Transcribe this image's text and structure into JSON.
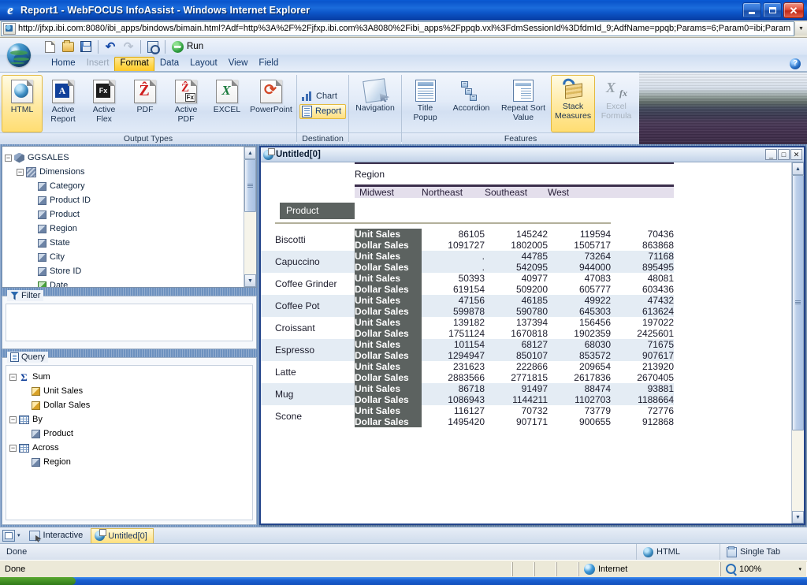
{
  "window": {
    "title": "Report1 - WebFOCUS InfoAssist - Windows Internet Explorer",
    "browser_icon": "ie-e-icon",
    "minimize_label": "Minimize",
    "maximize_label": "Maximize",
    "close_label": "Close"
  },
  "address": {
    "url": "http://jfxp.ibi.com:8080/ibi_apps/bindows/bimain.html?Adf=http%3A%2F%2Fjfxp.ibi.com%3A8080%2Fibi_apps%2Fppqb.vxl%3FdmSessionId%3DfdmId_9;AdfName=ppqb;Params=6;Param0=ibi;Param",
    "dropdown_glyph": "▼"
  },
  "quick_toolbar": {
    "buttons": [
      {
        "name": "new",
        "icon": "new-document-icon"
      },
      {
        "name": "open",
        "icon": "open-folder-icon"
      },
      {
        "name": "save",
        "icon": "save-disk-icon"
      },
      {
        "name": "undo",
        "icon": "undo-arrow-icon"
      },
      {
        "name": "redo",
        "icon": "redo-arrow-icon"
      },
      {
        "name": "preview",
        "icon": "preview-icon"
      }
    ],
    "run_label": "Run",
    "run_icon": "run-play-icon"
  },
  "menu": {
    "items": [
      {
        "label": "Home",
        "state": "normal"
      },
      {
        "label": "Insert",
        "state": "disabled"
      },
      {
        "label": "Format",
        "state": "active"
      },
      {
        "label": "Data",
        "state": "normal"
      },
      {
        "label": "Layout",
        "state": "normal"
      },
      {
        "label": "View",
        "state": "normal"
      },
      {
        "label": "Field",
        "state": "normal"
      }
    ],
    "help_glyph": "?"
  },
  "ribbon": {
    "groups": [
      {
        "title": "Output Types",
        "buttons": [
          {
            "label": "HTML",
            "icon": "html-globe-icon",
            "selected": true
          },
          {
            "label": "Active\nReport",
            "icon": "active-report-icon",
            "selected": false
          },
          {
            "label": "Active\nFlex",
            "icon": "active-flex-icon",
            "selected": false
          },
          {
            "label": "PDF",
            "icon": "pdf-icon",
            "selected": false
          },
          {
            "label": "Active\nPDF",
            "icon": "active-pdf-icon",
            "selected": false
          },
          {
            "label": "EXCEL",
            "icon": "excel-icon",
            "selected": false
          },
          {
            "label": "PowerPoint",
            "icon": "powerpoint-icon",
            "selected": false
          }
        ]
      },
      {
        "title": "Destination",
        "buttons": [
          {
            "label": "Chart",
            "icon": "chart-bars-icon",
            "selected": false
          },
          {
            "label": "Report",
            "icon": "report-page-icon",
            "selected": true
          }
        ]
      },
      {
        "title": "",
        "buttons": [
          {
            "label": "Navigation",
            "icon": "navigation-icon",
            "selected": false
          }
        ]
      },
      {
        "title": "Features",
        "buttons": [
          {
            "label": "Title\nPopup",
            "icon": "title-popup-icon",
            "selected": false,
            "disabled": false
          },
          {
            "label": "Accordion",
            "icon": "accordion-icon",
            "selected": false,
            "disabled": false
          },
          {
            "label": "Repeat Sort\nValue",
            "icon": "repeat-sort-icon",
            "selected": false,
            "disabled": false
          },
          {
            "label": "Stack\nMeasures",
            "icon": "stack-measures-icon",
            "selected": true,
            "disabled": false
          },
          {
            "label": "Excel\nFormula",
            "icon": "excel-formula-icon",
            "selected": false,
            "disabled": true
          }
        ]
      }
    ]
  },
  "data_tree": {
    "root": {
      "label": "GGSALES",
      "icon": "cube-icon",
      "expander": "−"
    },
    "dimensions": {
      "label": "Dimensions",
      "icon": "dimensions-icon",
      "expander": "−"
    },
    "fields": [
      {
        "label": "Category",
        "icon": "field-icon"
      },
      {
        "label": "Product ID",
        "icon": "field-icon"
      },
      {
        "label": "Product",
        "icon": "field-icon"
      },
      {
        "label": "Region",
        "icon": "field-icon"
      },
      {
        "label": "State",
        "icon": "field-icon"
      },
      {
        "label": "City",
        "icon": "field-icon"
      },
      {
        "label": "Store ID",
        "icon": "field-icon"
      },
      {
        "label": "Date",
        "icon": "field-date-icon"
      }
    ]
  },
  "filter_panel": {
    "title": "Filter",
    "icon": "filter-funnel-icon",
    "content": ""
  },
  "query_panel": {
    "title": "Query",
    "icon": "query-page-icon",
    "nodes": [
      {
        "label": "Sum",
        "icon": "sigma-icon",
        "expander": "−",
        "level": 0
      },
      {
        "label": "Unit Sales",
        "icon": "measure-field-icon",
        "level": 1
      },
      {
        "label": "Dollar Sales",
        "icon": "measure-field-icon",
        "level": 1
      },
      {
        "label": "By",
        "icon": "grid-icon",
        "expander": "−",
        "level": 0
      },
      {
        "label": "Product",
        "icon": "field-icon",
        "level": 1
      },
      {
        "label": "Across",
        "icon": "grid-icon",
        "expander": "−",
        "level": 0
      },
      {
        "label": "Region",
        "icon": "field-icon",
        "level": 1
      }
    ]
  },
  "report_window": {
    "title": "Untitled[0]",
    "icon": "document-globe-icon",
    "minimize_glyph": "_",
    "maximize_glyph": "□",
    "close_glyph": "✕"
  },
  "report": {
    "across_title": "Region",
    "across_columns": [
      "Midwest",
      "Northeast",
      "Southeast",
      "West"
    ],
    "sort_label": "Product",
    "measures": [
      "Unit Sales",
      "Dollar Sales"
    ],
    "rows": [
      {
        "product": "Biscotti",
        "unit_sales": [
          "86105",
          "145242",
          "119594",
          "70436"
        ],
        "dollar_sales": [
          "1091727",
          "1802005",
          "1505717",
          "863868"
        ]
      },
      {
        "product": "Capuccino",
        "unit_sales": [
          ".",
          "44785",
          "73264",
          "71168"
        ],
        "dollar_sales": [
          ".",
          "542095",
          "944000",
          "895495"
        ]
      },
      {
        "product": "Coffee Grinder",
        "unit_sales": [
          "50393",
          "40977",
          "47083",
          "48081"
        ],
        "dollar_sales": [
          "619154",
          "509200",
          "605777",
          "603436"
        ]
      },
      {
        "product": "Coffee Pot",
        "unit_sales": [
          "47156",
          "46185",
          "49922",
          "47432"
        ],
        "dollar_sales": [
          "599878",
          "590780",
          "645303",
          "613624"
        ]
      },
      {
        "product": "Croissant",
        "unit_sales": [
          "139182",
          "137394",
          "156456",
          "197022"
        ],
        "dollar_sales": [
          "1751124",
          "1670818",
          "1902359",
          "2425601"
        ]
      },
      {
        "product": "Espresso",
        "unit_sales": [
          "101154",
          "68127",
          "68030",
          "71675"
        ],
        "dollar_sales": [
          "1294947",
          "850107",
          "853572",
          "907617"
        ]
      },
      {
        "product": "Latte",
        "unit_sales": [
          "231623",
          "222866",
          "209654",
          "213920"
        ],
        "dollar_sales": [
          "2883566",
          "2771815",
          "2617836",
          "2670405"
        ]
      },
      {
        "product": "Mug",
        "unit_sales": [
          "86718",
          "91497",
          "88474",
          "93881"
        ],
        "dollar_sales": [
          "1086943",
          "1144211",
          "1102703",
          "1188664"
        ]
      },
      {
        "product": "Scone",
        "unit_sales": [
          "116127",
          "70732",
          "73779",
          "72776"
        ],
        "dollar_sales": [
          "1495420",
          "907171",
          "900655",
          "912868"
        ]
      }
    ],
    "colors": {
      "header_band": "#e4dfec",
      "header_rule": "#3c2f4c",
      "label_cell": "#5c6260",
      "alt_row": "#e4ecf4",
      "divider": "#b3b09b"
    }
  },
  "bottom_tabs": {
    "menu_icon": "tab-menu-icon",
    "caret": "▾",
    "tabs": [
      {
        "label": "Interactive",
        "icon": "interactive-icon",
        "active": false
      },
      {
        "label": "Untitled[0]",
        "icon": "document-globe-icon",
        "active": true
      }
    ]
  },
  "app_status": {
    "message": "Done",
    "output_format": "HTML",
    "output_icon": "html-globe-icon",
    "tab_mode": "Single Tab",
    "tab_icon": "single-tab-icon"
  },
  "browser_status": {
    "message": "Done",
    "zone": "Internet",
    "zone_icon": "internet-globe-icon",
    "zoom": "100%",
    "zoom_icon": "zoom-magnifier-icon",
    "zoom_caret": "▾"
  }
}
